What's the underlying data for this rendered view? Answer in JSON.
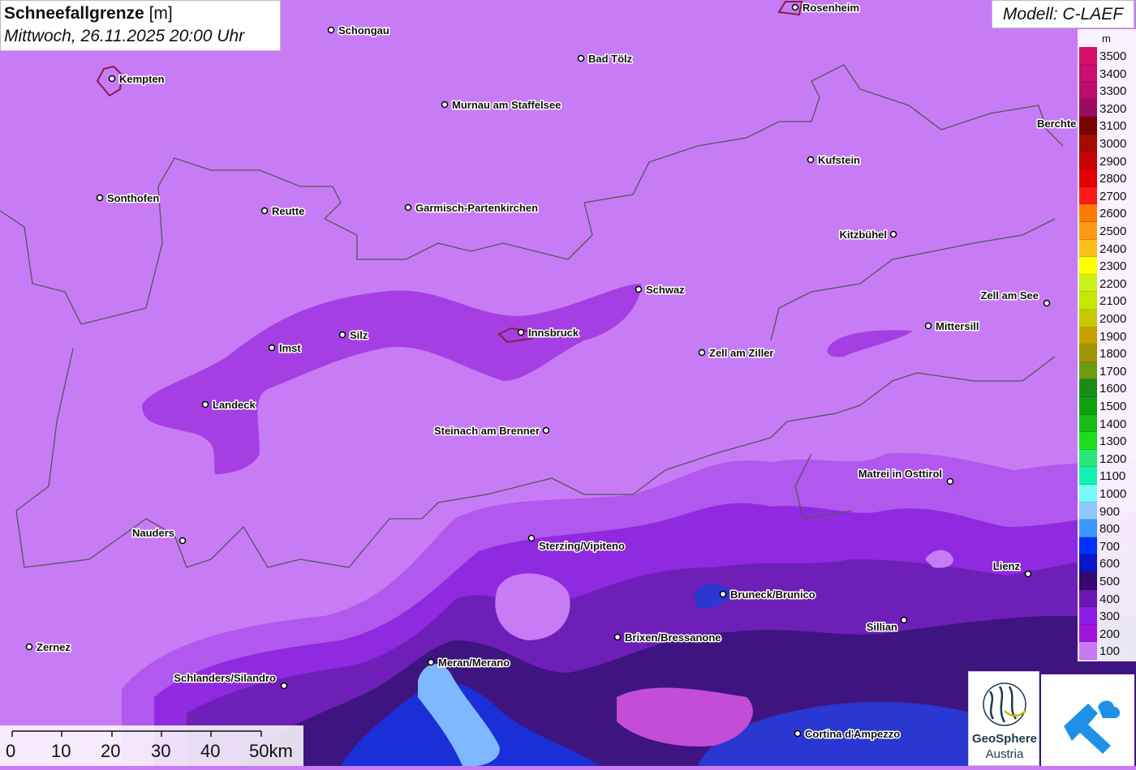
{
  "title": {
    "parameter": "Schneefallgrenze",
    "unit": "[m]",
    "datetime": "Mittwoch, 26.11.2025 20:00 Uhr"
  },
  "model_label": "Modell: C-LAEF",
  "legend": {
    "unit": "m",
    "entries": [
      {
        "value": "3500",
        "color": "#d7106b"
      },
      {
        "value": "3400",
        "color": "#cc0e6e"
      },
      {
        "value": "3300",
        "color": "#bb0b6c"
      },
      {
        "value": "3200",
        "color": "#9c0b62"
      },
      {
        "value": "3100",
        "color": "#7a0500"
      },
      {
        "value": "3000",
        "color": "#a50a00"
      },
      {
        "value": "2900",
        "color": "#c80000"
      },
      {
        "value": "2800",
        "color": "#e60000"
      },
      {
        "value": "2700",
        "color": "#ff1a1a"
      },
      {
        "value": "2600",
        "color": "#ff7a00"
      },
      {
        "value": "2500",
        "color": "#ff9a18"
      },
      {
        "value": "2400",
        "color": "#ffbf1a"
      },
      {
        "value": "2300",
        "color": "#ffff00"
      },
      {
        "value": "2200",
        "color": "#caf21a"
      },
      {
        "value": "2100",
        "color": "#c8e600"
      },
      {
        "value": "2000",
        "color": "#c8c800"
      },
      {
        "value": "1900",
        "color": "#c8a000"
      },
      {
        "value": "1800",
        "color": "#a09600"
      },
      {
        "value": "1700",
        "color": "#6e9a14"
      },
      {
        "value": "1600",
        "color": "#1a8a1a"
      },
      {
        "value": "1500",
        "color": "#0fa00f"
      },
      {
        "value": "1400",
        "color": "#18bc18"
      },
      {
        "value": "1300",
        "color": "#20dc20"
      },
      {
        "value": "1200",
        "color": "#28e678"
      },
      {
        "value": "1100",
        "color": "#14f0b4"
      },
      {
        "value": "1000",
        "color": "#78fafa"
      },
      {
        "value": "900",
        "color": "#8cc8ff"
      },
      {
        "value": "800",
        "color": "#3c96ff"
      },
      {
        "value": "700",
        "color": "#0032ff"
      },
      {
        "value": "600",
        "color": "#0a14c8"
      },
      {
        "value": "500",
        "color": "#34086e"
      },
      {
        "value": "400",
        "color": "#6e14b4"
      },
      {
        "value": "300",
        "color": "#8c1ee6"
      },
      {
        "value": "200",
        "color": "#a014dc"
      },
      {
        "value": "100",
        "color": "#c87af5"
      }
    ]
  },
  "cities": [
    {
      "name": "Schongau"
    },
    {
      "name": "Rosenheim"
    },
    {
      "name": "Kempten"
    },
    {
      "name": "Bad Tölz"
    },
    {
      "name": "Murnau am Staffelsee"
    },
    {
      "name": "Berchte"
    },
    {
      "name": "Kufstein"
    },
    {
      "name": "Sonthofen"
    },
    {
      "name": "Reutte"
    },
    {
      "name": "Garmisch-Partenkirchen"
    },
    {
      "name": "Kitzbühel"
    },
    {
      "name": "Schwaz"
    },
    {
      "name": "Zell am See"
    },
    {
      "name": "Imst"
    },
    {
      "name": "Silz"
    },
    {
      "name": "Innsbruck"
    },
    {
      "name": "Mittersill"
    },
    {
      "name": "Zell am Ziller"
    },
    {
      "name": "Landeck"
    },
    {
      "name": "Steinach am Brenner"
    },
    {
      "name": "Matrei in Osttirol"
    },
    {
      "name": "Nauders"
    },
    {
      "name": "Sterzing/Vipiteno"
    },
    {
      "name": "Lienz"
    },
    {
      "name": "Bruneck/Brunico"
    },
    {
      "name": "Sillian"
    },
    {
      "name": "Brixen/Bressanone"
    },
    {
      "name": "Zernez"
    },
    {
      "name": "Meran/Merano"
    },
    {
      "name": "Schlanders/Silandro"
    },
    {
      "name": "Cortina d'Ampezzo"
    }
  ],
  "scalebar": {
    "labels": [
      "0",
      "10",
      "20",
      "30",
      "40",
      "50km"
    ]
  },
  "logos": {
    "geosphere_line1": "GeoSphere",
    "geosphere_line2": "Austria"
  }
}
